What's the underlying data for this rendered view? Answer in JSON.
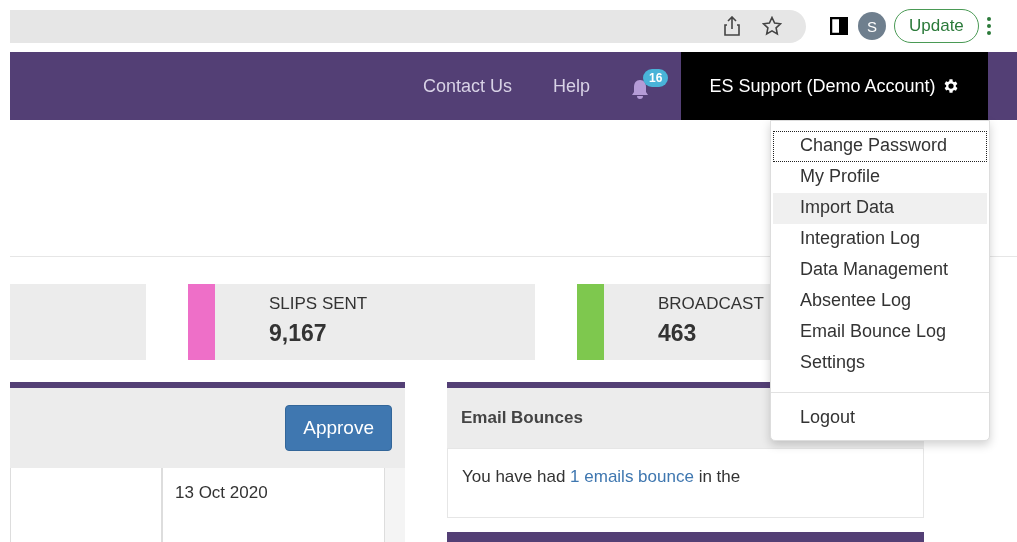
{
  "browser": {
    "avatar": "S",
    "update_button": "Update"
  },
  "nav": {
    "links": [
      "Contact Us",
      "Help"
    ],
    "notification_count": "16",
    "account": "ES Support (Demo Account)"
  },
  "stats": [
    {
      "label": "SLIPS SENT",
      "value": "9,167",
      "color": "#ee6fc8"
    },
    {
      "label": "BROADCAST",
      "value": "463",
      "color": "#7ec84e"
    }
  ],
  "approvals": {
    "button": "Approve",
    "date": "13 Oct 2020"
  },
  "bounces": {
    "title": "Email Bounces",
    "text": "You have had ",
    "link": "1 emails bounce",
    "text_after": " in the"
  },
  "menu": {
    "items": [
      {
        "label": "Change Password",
        "focused": true,
        "highlighted": false
      },
      {
        "label": "My Profile",
        "focused": false,
        "highlighted": false
      },
      {
        "label": "Import Data",
        "focused": false,
        "highlighted": true
      },
      {
        "label": "Integration Log",
        "focused": false,
        "highlighted": false
      },
      {
        "label": "Data Management",
        "focused": false,
        "highlighted": false
      },
      {
        "label": "Absentee Log",
        "focused": false,
        "highlighted": false
      },
      {
        "label": "Email Bounce Log",
        "focused": false,
        "highlighted": false
      },
      {
        "label": "Settings",
        "focused": false,
        "highlighted": false
      }
    ],
    "footer_item": "Logout"
  }
}
